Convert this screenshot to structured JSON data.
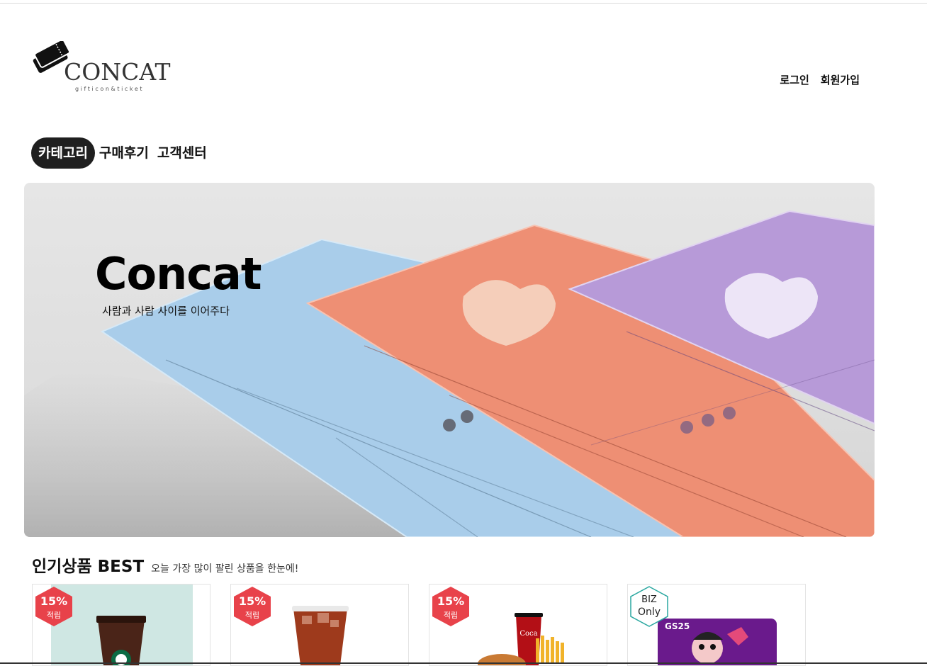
{
  "header": {
    "logo_word": "CONCAT",
    "logo_sub": "gifticon&ticket",
    "login": "로그인",
    "signup": "회원가입"
  },
  "nav": {
    "items": [
      {
        "label": "카테고리",
        "active": true
      },
      {
        "label": "구매후기",
        "active": false
      },
      {
        "label": "고객센터",
        "active": false
      }
    ]
  },
  "hero": {
    "title": "Concat",
    "subtitle": "사람과 사람 사이를 이어주다"
  },
  "best": {
    "title": "인기상품 BEST",
    "subtitle": "오늘 가장 많이 팔린 상품을 한눈에!",
    "products": [
      {
        "badge_pct": "15%",
        "badge_label": "적립"
      },
      {
        "badge_pct": "15%",
        "badge_label": "적립"
      },
      {
        "badge_pct": "15%",
        "badge_label": "적립"
      },
      {
        "badge_line1": "BIZ",
        "badge_line2": "Only",
        "brand": "GS25"
      }
    ]
  },
  "colors": {
    "badge_red": "#e8424a",
    "badge_biz_border": "#2aa7a0",
    "nav_active_bg": "#1f1f1f"
  }
}
